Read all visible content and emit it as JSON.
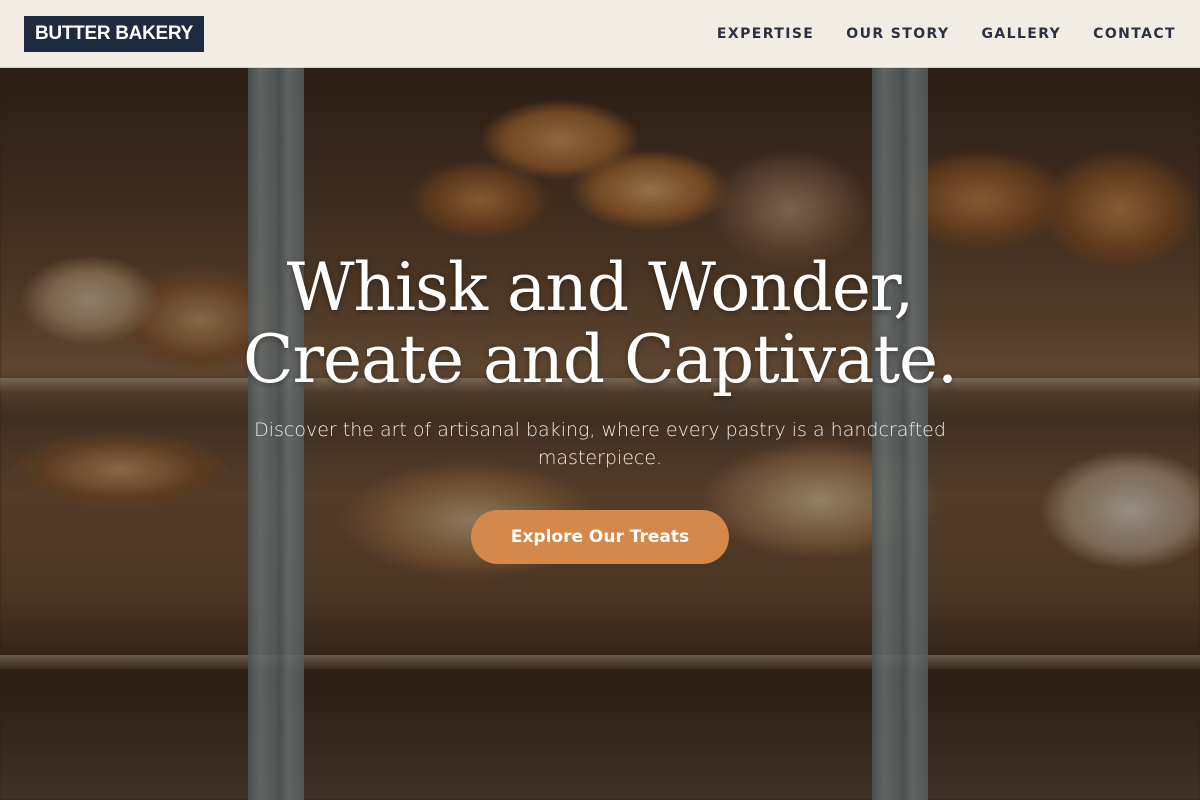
{
  "header": {
    "logo_text": "BUTTER BAKERY",
    "nav": [
      "EXPERTISE",
      "OUR STORY",
      "GALLERY",
      "CONTACT"
    ]
  },
  "hero": {
    "title_line1": "Whisk and Wonder,",
    "title_line2": "Create and Captivate.",
    "subtitle": "Discover the art of artisanal baking, where every pastry is a handcrafted masterpiece.",
    "cta_label": "Explore Our Treats",
    "background": "bakery-display-photo"
  },
  "colors": {
    "header_bg": "#f2ede4",
    "logo_bg": "#1d2a3f",
    "nav_text": "#2d3040",
    "cta_bg": "#d4894a",
    "hero_text": "#ffffff"
  }
}
